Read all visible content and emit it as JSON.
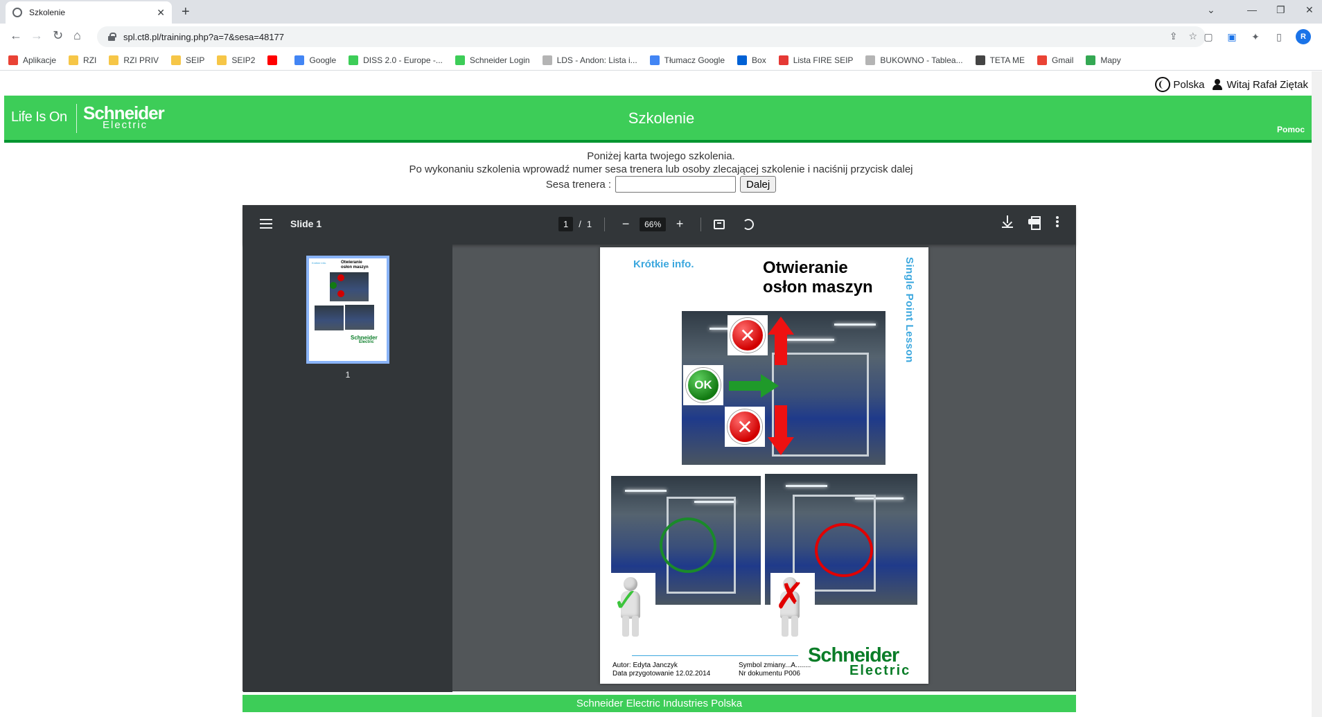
{
  "browser": {
    "tab_title": "Szkolenie",
    "url": "spl.ct8.pl/training.php?a=7&sesa=48177",
    "profile_initial": "R",
    "bookmarks": [
      {
        "label": "Aplikacje",
        "color": "#e94235"
      },
      {
        "label": "RZI",
        "color": "#f6c647"
      },
      {
        "label": "RZI PRIV",
        "color": "#f6c647"
      },
      {
        "label": "SEIP",
        "color": "#f6c647"
      },
      {
        "label": "SEIP2",
        "color": "#f6c647"
      },
      {
        "label": "",
        "color": "#ff0000"
      },
      {
        "label": "Google",
        "color": "#4285f4"
      },
      {
        "label": "DISS 2.0 - Europe -...",
        "color": "#3dcd58"
      },
      {
        "label": "Schneider Login",
        "color": "#3dcd58"
      },
      {
        "label": "LDS - Andon: Lista i...",
        "color": "#b4b4b4"
      },
      {
        "label": "Tłumacz Google",
        "color": "#4285f4"
      },
      {
        "label": "Box",
        "color": "#0061d5"
      },
      {
        "label": "Lista FIRE SEIP",
        "color": "#e53935"
      },
      {
        "label": "BUKOWNO - Tablea...",
        "color": "#b4b4b4"
      },
      {
        "label": "TETA ME",
        "color": "#444444"
      },
      {
        "label": "Gmail",
        "color": "#ea4335"
      },
      {
        "label": "Mapy",
        "color": "#34a853"
      }
    ]
  },
  "topbar": {
    "language": "Polska",
    "greeting": "Witaj Rafał Ziętak"
  },
  "header": {
    "tagline": "Life Is On",
    "brand_big": "Schneider",
    "brand_small": "Electric",
    "title": "Szkolenie",
    "help": "Pomoc",
    "color": "#3dcd58"
  },
  "instructions": {
    "line1": "Poniżej karta twojego szkolenia.",
    "line2": "Po wykonaniu szkolenia wprowadź numer sesa trenera lub osoby zlecającej szkolenie i naciśnij przycisk dalej",
    "sesa_label": "Sesa trenera :",
    "sesa_value": "",
    "next_button": "Dalej"
  },
  "pdf_viewer": {
    "title": "Slide 1",
    "current_page": "1",
    "page_separator": "/",
    "total_pages": "1",
    "zoom": "66%",
    "thumbnail_label": "1"
  },
  "slide": {
    "info_label": "Krótkie info.",
    "title_line1": "Otwieranie",
    "title_line2": "osłon maszyn",
    "side_label": "Single Point Lesson",
    "ok_label": "OK",
    "author": "Autor:  Edyta Janczyk",
    "prep_date": "Data przygotowanie  12.02.2014",
    "change_symbol": "Symbol zmiany...A........",
    "doc_number": "Nr dokumentu P006",
    "logo_big": "Schneider",
    "logo_small": "Electric"
  },
  "footer": {
    "text": "Schneider Electric Industries Polska"
  }
}
